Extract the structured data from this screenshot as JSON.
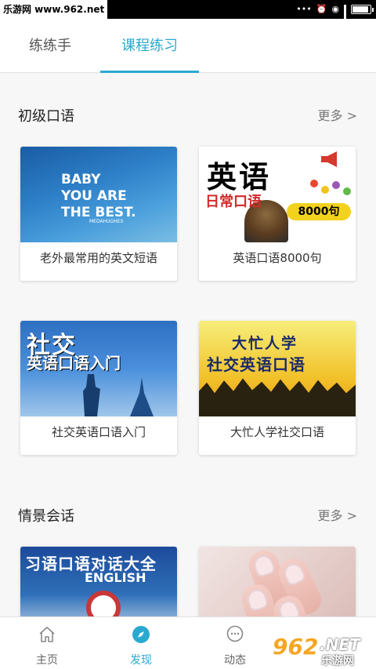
{
  "status_bar": {
    "watermark": "乐游网 www.962.net",
    "icons": [
      "more-icon",
      "alarm-icon",
      "wifi-icon",
      "signal-icon",
      "battery-icon"
    ]
  },
  "tabs": [
    {
      "label": "练练手",
      "active": false
    },
    {
      "label": "课程练习",
      "active": true
    }
  ],
  "accent_color": "#2aa9cf",
  "sections": [
    {
      "title": "初级口语",
      "more": "更多 >",
      "cards": [
        {
          "caption": "老外最常用的英文短语",
          "thumb_text": [
            "BABY",
            "YOU ARE",
            "THE BEST."
          ],
          "thumb_sub": "MEDAHUGHES"
        },
        {
          "caption": "英语口语8000句",
          "thumb_text": [
            "英语",
            "日常口语",
            "8000句"
          ]
        }
      ]
    },
    {
      "cards": [
        {
          "caption": "社交英语口语入门",
          "thumb_text": [
            "社交",
            "英语口语入门"
          ]
        },
        {
          "caption": "大忙人学社交口语",
          "thumb_text": [
            "大忙人学",
            "社交英语口语"
          ]
        }
      ]
    },
    {
      "title": "情景会话",
      "more": "更多 >",
      "cards": [
        {
          "thumb_text": [
            "习语口语对话大全",
            "ENGLISH"
          ]
        },
        {}
      ]
    }
  ],
  "bottom_nav": [
    {
      "label": "主页",
      "icon": "home-icon",
      "active": false
    },
    {
      "label": "发现",
      "icon": "compass-icon",
      "active": true
    },
    {
      "label": "动态",
      "icon": "chat-icon",
      "active": false
    }
  ],
  "site_logo": {
    "num": "962",
    "net": ".NET",
    "cn": "乐游网"
  }
}
